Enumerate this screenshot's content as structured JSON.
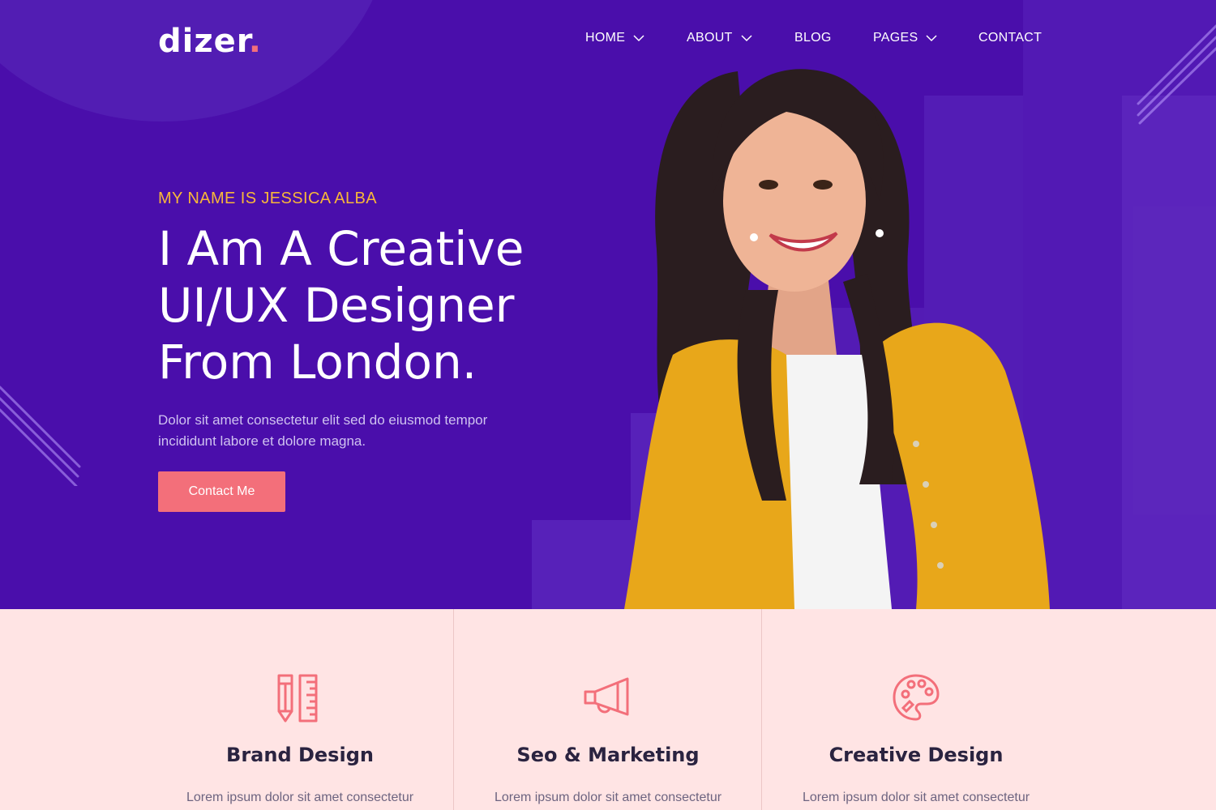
{
  "brand": {
    "name": "dizer",
    "dot": "."
  },
  "nav": {
    "items": [
      {
        "label": "HOME",
        "has_dropdown": true
      },
      {
        "label": "ABOUT",
        "has_dropdown": true
      },
      {
        "label": "BLOG",
        "has_dropdown": false
      },
      {
        "label": "PAGES",
        "has_dropdown": true
      },
      {
        "label": "CONTACT",
        "has_dropdown": false
      }
    ]
  },
  "hero": {
    "eyebrow": "MY NAME IS JESSICA ALBA",
    "headline": [
      "I Am A Creative",
      "UI/UX Designer",
      "From London."
    ],
    "lead": "Dolor sit amet consectetur elit sed do eiusmod tempor incididunt labore et dolore magna.",
    "cta_label": "Contact Me"
  },
  "services": [
    {
      "icon": "pencil-ruler-icon",
      "title": "Brand Design",
      "text": "Lorem ipsum dolor sit amet consectetur"
    },
    {
      "icon": "megaphone-icon",
      "title": "Seo & Marketing",
      "text": "Lorem ipsum dolor sit amet consectetur"
    },
    {
      "icon": "palette-icon",
      "title": "Creative Design",
      "text": "Lorem ipsum dolor sit amet consectetur"
    }
  ],
  "colors": {
    "hero_bg": "#4a0eab",
    "accent": "#f36f7a",
    "eyebrow": "#f8b739",
    "services_bg": "#ffe4e4"
  }
}
